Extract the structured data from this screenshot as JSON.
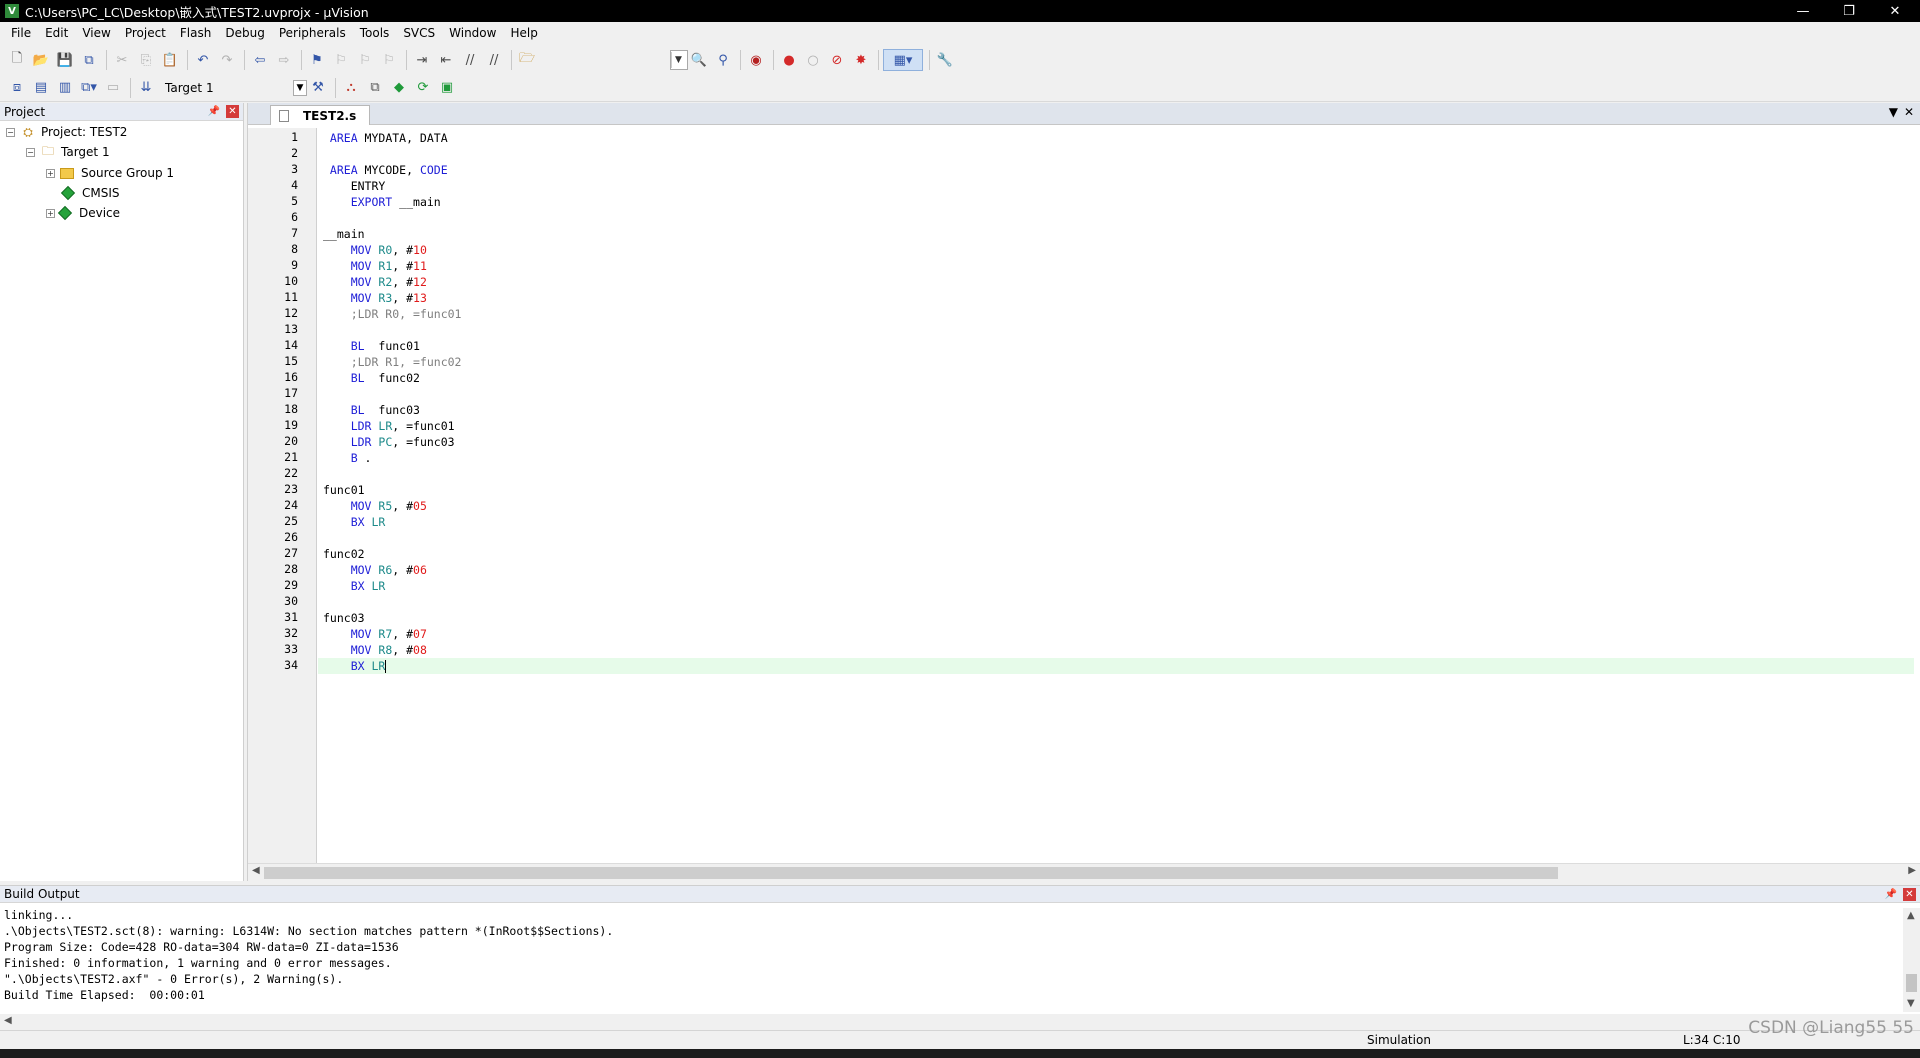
{
  "window": {
    "title": "C:\\Users\\PC_LC\\Desktop\\嵌入式\\TEST2.uvprojx - µVision",
    "app_icon": "V",
    "minimize_label": "—",
    "restore_label": "❐",
    "close_label": "✕"
  },
  "menu": {
    "items": [
      "File",
      "Edit",
      "View",
      "Project",
      "Flash",
      "Debug",
      "Peripherals",
      "Tools",
      "SVCS",
      "Window",
      "Help"
    ]
  },
  "toolbar": {
    "target_name": "Target 1"
  },
  "project_panel": {
    "title": "Project",
    "root": "Project: TEST2",
    "target": "Target 1",
    "items": [
      "Source Group 1",
      "CMSIS",
      "Device"
    ]
  },
  "editor": {
    "tab_label": "TEST2.s",
    "line_numbers": [
      "1",
      "2",
      "3",
      "4",
      "5",
      "6",
      "7",
      "8",
      "9",
      "10",
      "11",
      "12",
      "13",
      "14",
      "15",
      "16",
      "17",
      "18",
      "19",
      "20",
      "21",
      "22",
      "23",
      "24",
      "25",
      "26",
      "27",
      "28",
      "29",
      "30",
      "31",
      "32",
      "33",
      "34"
    ],
    "lines": [
      [
        {
          "t": " AREA ",
          "c": "kw"
        },
        {
          "t": "MYDATA, DATA",
          "c": ""
        }
      ],
      [],
      [
        {
          "t": " AREA ",
          "c": "kw"
        },
        {
          "t": "MYCODE, ",
          "c": ""
        },
        {
          "t": "CODE",
          "c": "kw"
        }
      ],
      [
        {
          "t": "    ENTRY",
          "c": ""
        }
      ],
      [
        {
          "t": "    EXPORT ",
          "c": "kw"
        },
        {
          "t": "__main",
          "c": ""
        }
      ],
      [],
      [
        {
          "t": "__main",
          "c": ""
        }
      ],
      [
        {
          "t": "    MOV ",
          "c": "kw"
        },
        {
          "t": "R0",
          "c": "reg"
        },
        {
          "t": ", #",
          "c": ""
        },
        {
          "t": "10",
          "c": "num"
        }
      ],
      [
        {
          "t": "    MOV ",
          "c": "kw"
        },
        {
          "t": "R1",
          "c": "reg"
        },
        {
          "t": ", #",
          "c": ""
        },
        {
          "t": "11",
          "c": "num"
        }
      ],
      [
        {
          "t": "    MOV ",
          "c": "kw"
        },
        {
          "t": "R2",
          "c": "reg"
        },
        {
          "t": ", #",
          "c": ""
        },
        {
          "t": "12",
          "c": "num"
        }
      ],
      [
        {
          "t": "    MOV ",
          "c": "kw"
        },
        {
          "t": "R3",
          "c": "reg"
        },
        {
          "t": ", #",
          "c": ""
        },
        {
          "t": "13",
          "c": "num"
        }
      ],
      [
        {
          "t": "    ;LDR R0, =func01",
          "c": "cm"
        }
      ],
      [],
      [
        {
          "t": "    BL  ",
          "c": "kw"
        },
        {
          "t": "func01",
          "c": ""
        }
      ],
      [
        {
          "t": "    ;LDR R1, =func02",
          "c": "cm"
        }
      ],
      [
        {
          "t": "    BL  ",
          "c": "kw"
        },
        {
          "t": "func02",
          "c": ""
        }
      ],
      [],
      [
        {
          "t": "    BL  ",
          "c": "kw"
        },
        {
          "t": "func03",
          "c": ""
        }
      ],
      [
        {
          "t": "    LDR ",
          "c": "kw"
        },
        {
          "t": "LR",
          "c": "reg"
        },
        {
          "t": ", =func01",
          "c": ""
        }
      ],
      [
        {
          "t": "    LDR ",
          "c": "kw"
        },
        {
          "t": "PC",
          "c": "reg"
        },
        {
          "t": ", =func03",
          "c": ""
        }
      ],
      [
        {
          "t": "    B ",
          "c": "kw"
        },
        {
          "t": ".",
          "c": ""
        }
      ],
      [],
      [
        {
          "t": "func01",
          "c": ""
        }
      ],
      [
        {
          "t": "    MOV ",
          "c": "kw"
        },
        {
          "t": "R5",
          "c": "reg"
        },
        {
          "t": ", #",
          "c": ""
        },
        {
          "t": "05",
          "c": "num"
        }
      ],
      [
        {
          "t": "    BX ",
          "c": "kw"
        },
        {
          "t": "LR",
          "c": "reg"
        }
      ],
      [],
      [
        {
          "t": "func02",
          "c": ""
        }
      ],
      [
        {
          "t": "    MOV ",
          "c": "kw"
        },
        {
          "t": "R6",
          "c": "reg"
        },
        {
          "t": ", #",
          "c": ""
        },
        {
          "t": "06",
          "c": "num"
        }
      ],
      [
        {
          "t": "    BX ",
          "c": "kw"
        },
        {
          "t": "LR",
          "c": "reg"
        }
      ],
      [],
      [
        {
          "t": "func03",
          "c": ""
        }
      ],
      [
        {
          "t": "    MOV ",
          "c": "kw"
        },
        {
          "t": "R7",
          "c": "reg"
        },
        {
          "t": ", #",
          "c": ""
        },
        {
          "t": "07",
          "c": "num"
        }
      ],
      [
        {
          "t": "    MOV ",
          "c": "kw"
        },
        {
          "t": "R8",
          "c": "reg"
        },
        {
          "t": ", #",
          "c": ""
        },
        {
          "t": "08",
          "c": "num"
        }
      ],
      [
        {
          "t": "    BX ",
          "c": "kw"
        },
        {
          "t": "LR",
          "c": "reg"
        }
      ]
    ],
    "current_line": 34
  },
  "build_output": {
    "title": "Build Output",
    "lines": [
      "linking...",
      ".\\Objects\\TEST2.sct(8): warning: L6314W: No section matches pattern *(InRoot$$Sections).",
      "Program Size: Code=428 RO-data=304 RW-data=0 ZI-data=1536",
      "Finished: 0 information, 1 warning and 0 error messages.",
      "\".\\Objects\\TEST2.axf\" - 0 Error(s), 2 Warning(s).",
      "Build Time Elapsed:  00:00:01"
    ]
  },
  "status": {
    "mode": "Simulation",
    "position": "L:34 C:10",
    "watermark": "CSDN @Liang55 55"
  },
  "colors": {
    "keyword": "#1d1dd6",
    "register": "#1d8a8a",
    "number": "#e01a1a",
    "comment": "#7f7f7f",
    "current_line": "#e6fbe9"
  }
}
